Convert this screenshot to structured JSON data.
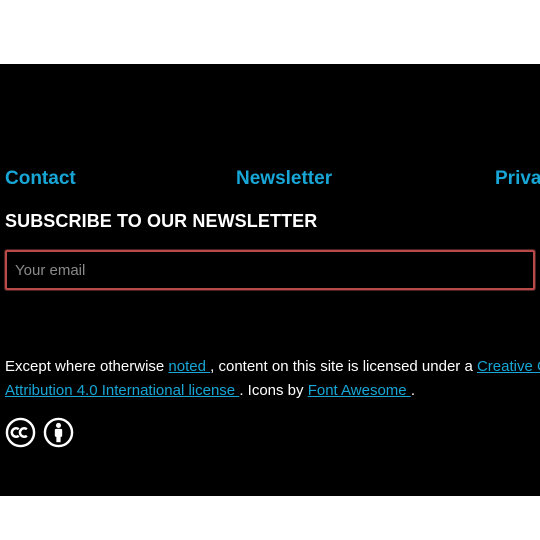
{
  "nav": {
    "contact": "Contact",
    "newsletter": "Newsletter",
    "privacy": "Priva"
  },
  "subscribe": {
    "heading": "SUBSCRIBE TO OUR NEWSLETTER",
    "email_placeholder": "Your email"
  },
  "license": {
    "prefix": "Except where otherwise ",
    "noted_link": "noted ",
    "middle": ", content on this site is licensed under a ",
    "cc_link_line1": "Creative C",
    "cc_link_line2": "Attribution 4.0 International license ",
    "icons_text": ". Icons by ",
    "font_awesome_link": "Font Awesome ",
    "suffix": "."
  },
  "icons": {
    "cc": "creative-commons-icon",
    "by": "attribution-icon"
  },
  "colors": {
    "background": "#000000",
    "link": "#17a6d6",
    "text": "#ffffff",
    "input_border": "#b84a4a"
  }
}
